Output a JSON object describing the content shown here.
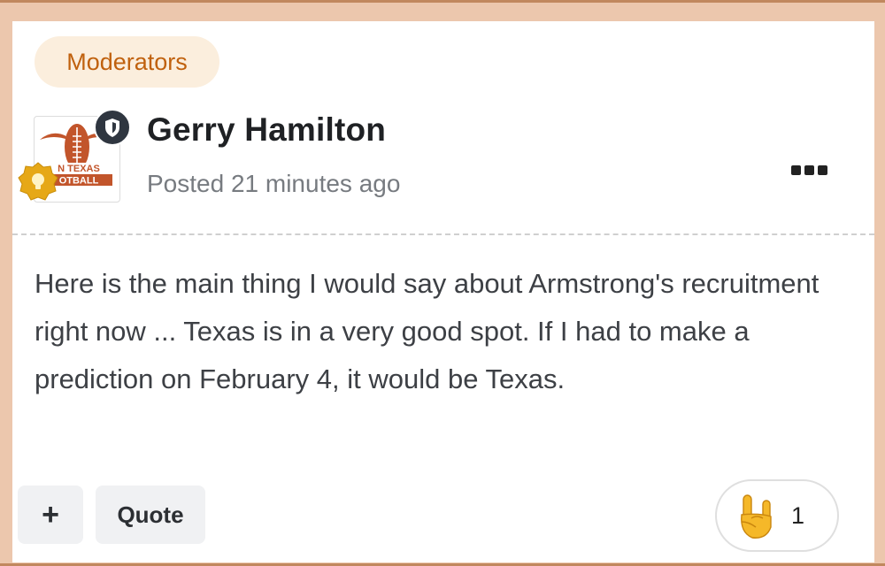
{
  "post": {
    "group_badge": "Moderators",
    "avatar_text_line1": "N TEXAS",
    "avatar_text_line2": "OTBALL",
    "author": "Gerry Hamilton",
    "posted": "Posted 21 minutes ago",
    "body": "Here is the main thing I would say about Armstrong's recruitment right now ... Texas is in a very good spot. If I had to make a prediction on February 4, it would be Texas.",
    "menu_icon": "more-options-icon",
    "moderator_icon": "shield-icon",
    "rank_icon": "lightbulb-icon"
  },
  "actions": {
    "plus_label": "+",
    "quote_label": "Quote"
  },
  "reaction": {
    "icon": "rock-on-hand-icon",
    "count": "1"
  },
  "colors": {
    "background": "#ecc7ad",
    "frame_border": "#c1885e",
    "badge_bg": "#fbeedd",
    "badge_text": "#c0610e",
    "rank_badge": "#e6a817",
    "avatar_accent": "#c2552b"
  }
}
